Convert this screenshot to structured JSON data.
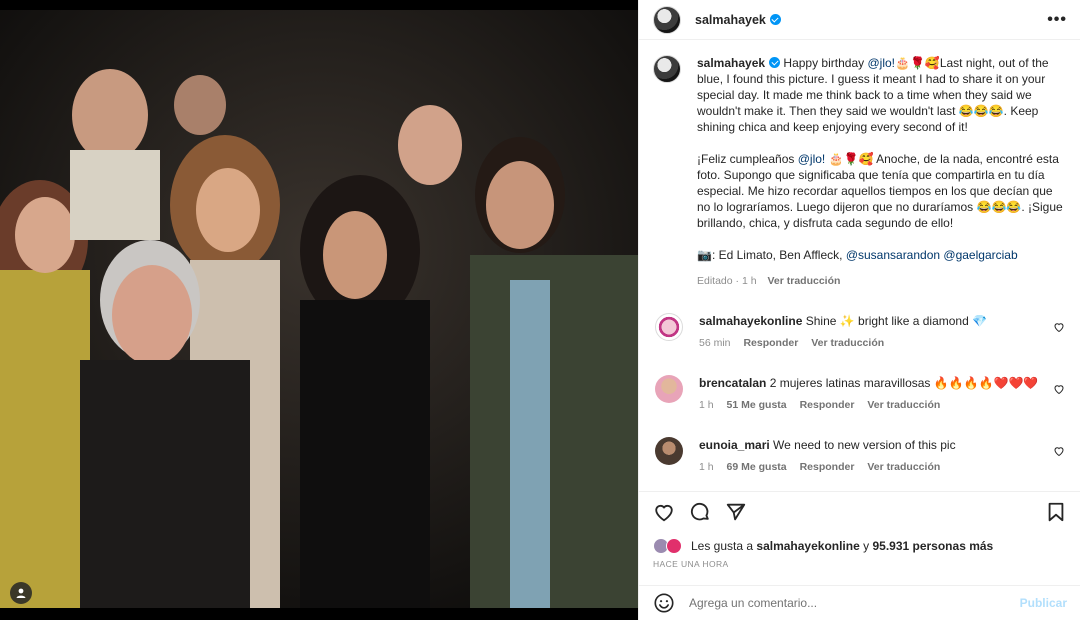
{
  "header": {
    "username": "salmahayek",
    "more_icon": "more-options-icon"
  },
  "caption": {
    "username": "salmahayek",
    "english": "Happy birthday",
    "mention_en": "@jlo!",
    "english_rest": "🎂🌹🥰Last night, out of the blue, I found this picture. I guess it meant I had to share it on your special day. It made me think back to a time when they said we wouldn't make it. Then they said we wouldn't last 😂😂😂. Keep shining chica and keep enjoying every second of it!",
    "spanish": "¡Feliz cumpleaños",
    "mention_es": "@jlo!",
    "spanish_rest": "🎂🌹🥰 Anoche, de la nada, encontré esta foto. Supongo que significaba que tenía que compartirla en tu día especial. Me hizo recordar aquellos tiempos en los que decían que no lo lograríamos. Luego dijeron que no duraríamos 😂😂😂. ¡Sigue brillando, chica, y disfruta cada segundo de ello!",
    "credits_prefix": "📷: Ed Limato, Ben Affleck,",
    "credit_mention_1": "@susansarandon",
    "credit_mention_2": "@gaelgarciab",
    "edited": "Editado · 1 h",
    "see_translation": "Ver traducción"
  },
  "comments": [
    {
      "username": "salmahayekonline",
      "text": "Shine ✨ bright like a diamond 💎",
      "time": "56 min",
      "likes": "",
      "reply": "Responder",
      "translate": "Ver traducción",
      "avatar_color": "#c13584"
    },
    {
      "username": "brencatalan",
      "text": "2 mujeres latinas maravillosas 🔥🔥🔥🔥❤️❤️❤️",
      "time": "1 h",
      "likes": "51 Me gusta",
      "reply": "Responder",
      "translate": "Ver traducción",
      "avatar_color": "#e8a4b8"
    },
    {
      "username": "eunoia_mari",
      "text": "We need to new version of this pic",
      "time": "1 h",
      "likes": "69 Me gusta",
      "reply": "Responder",
      "translate": "Ver traducción",
      "avatar_color": "#4a3a30"
    }
  ],
  "likes": {
    "prefix": "Les gusta a",
    "user": "salmahayekonline",
    "middle": "y",
    "count": "95.931 personas más"
  },
  "timestamp": "HACE UNA HORA",
  "add_comment": {
    "placeholder": "Agrega un comentario...",
    "post": "Publicar"
  }
}
